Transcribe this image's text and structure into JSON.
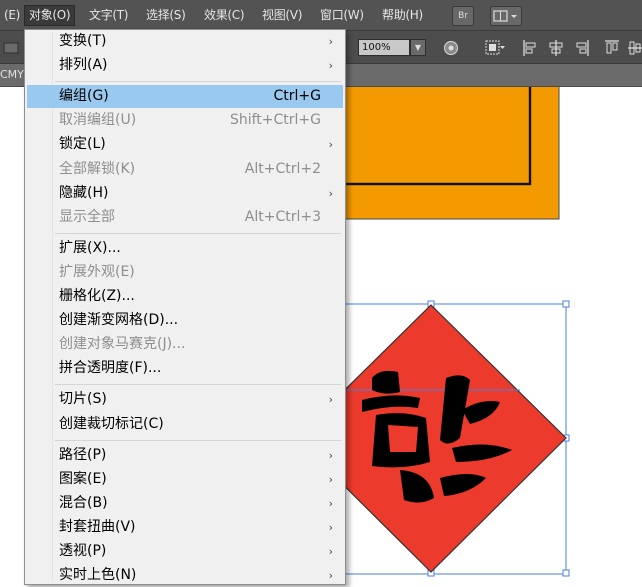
{
  "menubar": {
    "items": [
      {
        "label": "(E)"
      },
      {
        "label": "对象(O)",
        "active": true
      },
      {
        "label": "文字(T)"
      },
      {
        "label": "选择(S)"
      },
      {
        "label": "效果(C)"
      },
      {
        "label": "视图(V)"
      },
      {
        "label": "窗口(W)"
      },
      {
        "label": "帮助(H)"
      }
    ],
    "br_label": "Br"
  },
  "controlbar": {
    "zoom_value": "100%"
  },
  "doctab": {
    "text": "CMY"
  },
  "artwork": {
    "character": "福",
    "colors": {
      "orange": "#f39a00",
      "diamond_red": "#ec3a2c",
      "ink": "#000000",
      "selection": "#4a7de0"
    }
  },
  "dropdown": {
    "items": [
      {
        "label": "变换(T)",
        "submenu": true
      },
      {
        "label": "排列(A)",
        "submenu": true
      },
      {
        "separator": true
      },
      {
        "label": "编组(G)",
        "shortcut": "Ctrl+G",
        "selected": true
      },
      {
        "label": "取消编组(U)",
        "shortcut": "Shift+Ctrl+G",
        "disabled": true
      },
      {
        "label": "锁定(L)",
        "submenu": true
      },
      {
        "label": "全部解锁(K)",
        "shortcut": "Alt+Ctrl+2",
        "disabled": true
      },
      {
        "label": "隐藏(H)",
        "submenu": true
      },
      {
        "label": "显示全部",
        "shortcut": "Alt+Ctrl+3",
        "disabled": true
      },
      {
        "separator": true
      },
      {
        "label": "扩展(X)..."
      },
      {
        "label": "扩展外观(E)",
        "disabled": true
      },
      {
        "label": "栅格化(Z)..."
      },
      {
        "label": "创建渐变网格(D)..."
      },
      {
        "label": "创建对象马赛克(J)...",
        "disabled": true
      },
      {
        "label": "拼合透明度(F)..."
      },
      {
        "separator": true
      },
      {
        "label": "切片(S)",
        "submenu": true
      },
      {
        "label": "创建裁切标记(C)"
      },
      {
        "separator": true
      },
      {
        "label": "路径(P)",
        "submenu": true
      },
      {
        "label": "图案(E)",
        "submenu": true
      },
      {
        "label": "混合(B)",
        "submenu": true
      },
      {
        "label": "封套扭曲(V)",
        "submenu": true
      },
      {
        "label": "透视(P)",
        "submenu": true
      },
      {
        "label": "实时上色(N)",
        "submenu": true
      }
    ],
    "arrow_glyph": "›"
  }
}
